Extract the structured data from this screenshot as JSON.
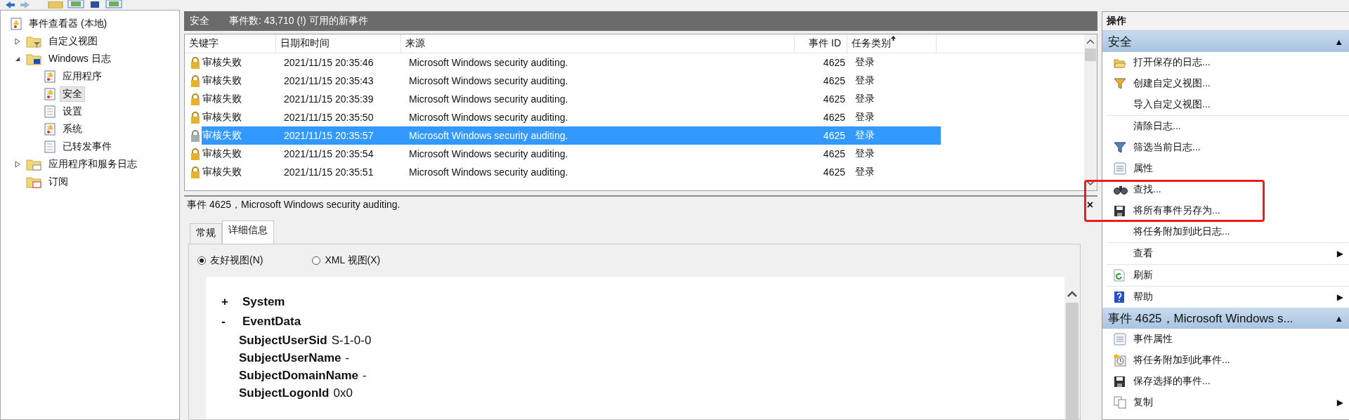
{
  "tree": [
    {
      "label": "事件查看器 (本地)",
      "selected": false,
      "children": [
        {
          "label": "自定义视图",
          "kind": "filter",
          "expanded": false,
          "selected": false
        },
        {
          "label": "Windows 日志",
          "kind": "windows",
          "expanded": true,
          "selected": false,
          "children": [
            {
              "label": "应用程序",
              "kind": "warning",
              "selected": false
            },
            {
              "label": "安全",
              "kind": "warning",
              "selected": true
            },
            {
              "label": "设置",
              "kind": "plain",
              "selected": false
            },
            {
              "label": "系统",
              "kind": "warning",
              "selected": false
            },
            {
              "label": "已转发事件",
              "kind": "plain",
              "selected": false
            }
          ]
        },
        {
          "label": "应用程序和服务日志",
          "kind": "folder",
          "expanded": false,
          "selected": false
        },
        {
          "label": "订阅",
          "kind": "subscription",
          "selected": false
        }
      ]
    }
  ],
  "log_header": {
    "title": "安全",
    "summary": "事件数: 43,710 (!) 可用的新事件"
  },
  "table": {
    "columns": [
      {
        "label": "关键字",
        "sorted": false
      },
      {
        "label": "日期和时间",
        "sorted": false
      },
      {
        "label": "来源",
        "sorted": false
      },
      {
        "label": "事件 ID",
        "sorted": false
      },
      {
        "label": "任务类别",
        "sorted": true
      }
    ],
    "rows": [
      {
        "keyword": "审核失败",
        "datetime": "2021/11/15 20:35:46",
        "source": "Microsoft Windows security auditing.",
        "event_id": "4625",
        "task": "登录",
        "selected": false
      },
      {
        "keyword": "审核失败",
        "datetime": "2021/11/15 20:35:43",
        "source": "Microsoft Windows security auditing.",
        "event_id": "4625",
        "task": "登录",
        "selected": false
      },
      {
        "keyword": "审核失败",
        "datetime": "2021/11/15 20:35:39",
        "source": "Microsoft Windows security auditing.",
        "event_id": "4625",
        "task": "登录",
        "selected": false
      },
      {
        "keyword": "审核失败",
        "datetime": "2021/11/15 20:35:50",
        "source": "Microsoft Windows security auditing.",
        "event_id": "4625",
        "task": "登录",
        "selected": false
      },
      {
        "keyword": "审核失败",
        "datetime": "2021/11/15 20:35:57",
        "source": "Microsoft Windows security auditing.",
        "event_id": "4625",
        "task": "登录",
        "selected": true
      },
      {
        "keyword": "审核失败",
        "datetime": "2021/11/15 20:35:54",
        "source": "Microsoft Windows security auditing.",
        "event_id": "4625",
        "task": "登录",
        "selected": false
      },
      {
        "keyword": "审核失败",
        "datetime": "2021/11/15 20:35:51",
        "source": "Microsoft Windows security auditing.",
        "event_id": "4625",
        "task": "登录",
        "selected": false
      }
    ]
  },
  "detail": {
    "title": "事件 4625，Microsoft Windows security auditing.",
    "close": "×",
    "tabs": [
      {
        "label": "常规",
        "selected": false
      },
      {
        "label": "详细信息",
        "selected": true
      }
    ],
    "views": [
      {
        "label": "友好视图(N)",
        "selected": true
      },
      {
        "label": "XML 视图(X)",
        "selected": false
      }
    ],
    "nodes": [
      {
        "toggle": "+",
        "label": "System"
      },
      {
        "toggle": "-",
        "label": "EventData",
        "fields": [
          {
            "name": "SubjectUserSid",
            "value": "S-1-0-0"
          },
          {
            "name": "SubjectUserName",
            "value": "-"
          },
          {
            "name": "SubjectDomainName",
            "value": "-"
          },
          {
            "name": "SubjectLogonId",
            "value": "0x0"
          }
        ]
      }
    ]
  },
  "actions": {
    "title": "操作",
    "sections": [
      {
        "title": "安全",
        "toggle": "▲",
        "items": [
          {
            "label": "打开保存的日志...",
            "kind": "folder-open",
            "divider_before": false
          },
          {
            "label": "创建自定义视图...",
            "kind": "filter-gold",
            "divider_before": false
          },
          {
            "label": "导入自定义视图...",
            "kind": "none",
            "divider_before": false
          },
          {
            "label": "清除日志...",
            "kind": "none",
            "divider_before": true
          },
          {
            "label": "筛选当前日志...",
            "kind": "filter",
            "divider_before": false
          },
          {
            "label": "属性",
            "kind": "properties",
            "divider_before": false
          },
          {
            "label": "查找...",
            "kind": "binoculars",
            "divider_before": false
          },
          {
            "label": "将所有事件另存为...",
            "kind": "save",
            "divider_before": false
          },
          {
            "label": "将任务附加到此日志...",
            "kind": "none",
            "divider_before": false
          },
          {
            "label": "查看",
            "kind": "none",
            "arrow": "▶",
            "divider_before": true
          },
          {
            "label": "刷新",
            "kind": "refresh",
            "divider_before": true
          },
          {
            "label": "帮助",
            "kind": "help",
            "arrow": "▶",
            "divider_before": true
          }
        ]
      },
      {
        "title": "事件 4625，Microsoft Windows s...",
        "toggle": "▲",
        "items": [
          {
            "label": "事件属性",
            "kind": "properties",
            "divider_before": false
          },
          {
            "label": "将任务附加到此事件...",
            "kind": "task",
            "divider_before": false
          },
          {
            "label": "保存选择的事件...",
            "kind": "save",
            "divider_before": false
          },
          {
            "label": "复制",
            "kind": "copy",
            "arrow": "▶",
            "divider_before": false
          }
        ]
      }
    ]
  }
}
